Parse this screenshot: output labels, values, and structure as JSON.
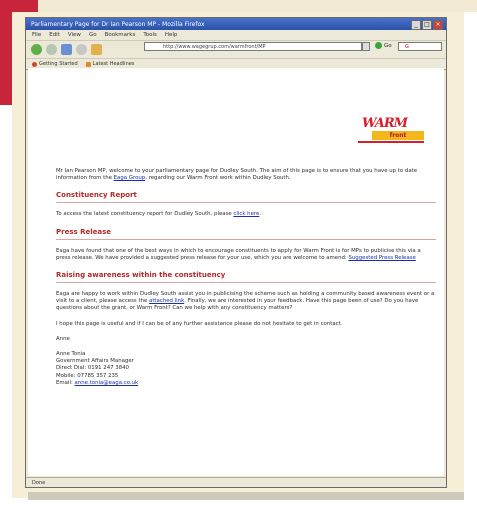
{
  "colors": {
    "accent_red": "#c8243a",
    "frame": "#f6eed6",
    "heading": "#b12a2a",
    "link": "#1a2fa8"
  },
  "window": {
    "title": "Parliamentary Page for Dr Ian Pearson MP - Mozilla Firefox"
  },
  "menu": [
    "File",
    "Edit",
    "View",
    "Go",
    "Bookmarks",
    "Tools",
    "Help"
  ],
  "toolbar": {
    "url": "http://www.wagegrup.com/warmfront/MP",
    "go_label": "Go",
    "search_value": "G"
  },
  "bookmarks": [
    {
      "label": "Getting Started",
      "icon": "firefox-icon"
    },
    {
      "label": "Latest Headlines",
      "icon": "rss-icon"
    }
  ],
  "logo": {
    "line1": "WARM",
    "line2": "front",
    "icon": "warm-front-logo"
  },
  "content": {
    "intro_a": "Mr Ian Pearson MP, welcome to your parliamentary page for Dudley South. The aim of this page is to ensure that you have up to date information from the ",
    "intro_link": "Eaga Group",
    "intro_b": ", regarding our Warm Front work within Dudley South.",
    "section1_title": "Constituency Report",
    "section1_text": "To access the latest constituency report for Dudley South, please ",
    "section1_link": "click here",
    "section1_end": ".",
    "section2_title": "Press Release",
    "section2_text": "Eaga have found that one of the best ways in which to encourage constituents to apply for Warm Front is for MPs to publicise this via a press release. We have provided a suggested press release for your use, which you are welcome to amend: ",
    "section2_link": "Suggested Press Release",
    "section3_title": "Raising awareness within the constituency",
    "section3_text_a": "Eaga are happy to work within Dudley South assist you in publicising the scheme such as holding a community based awareness event or a visit to a client, please access the ",
    "section3_link": "attached link",
    "section3_text_b": ". Finally, we are interested in your feedback. Have this page been of use? Do you have questions about the grant, or Warm Front? Can we help with any constituency matters?",
    "closing": "I hope this page is useful and if I can be of any further assistance please do not hesitate to get in contact.",
    "signoff": "Anne",
    "sig_name": "Anne Tonia",
    "sig_role": "Government Affairs Manager",
    "sig_direct": "Direct Dial: 0191 247 3840",
    "sig_mobile": "Mobile: 07785 357 235",
    "sig_email_label": "Email: ",
    "sig_email": "anne.tonia@eaga.co.uk"
  },
  "statusbar": {
    "text": "Done"
  }
}
